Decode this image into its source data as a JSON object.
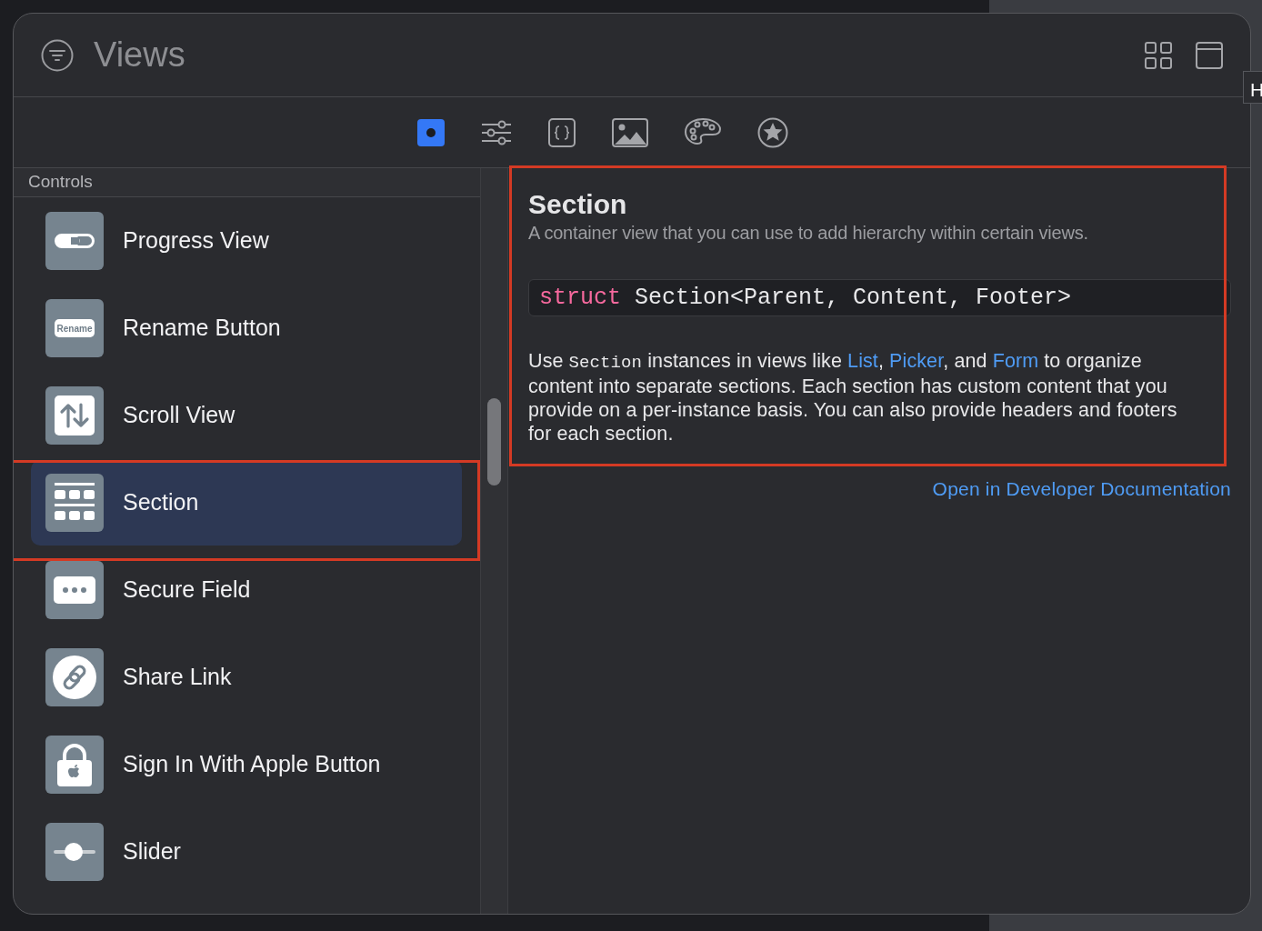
{
  "window": {
    "title": "Views"
  },
  "tooltip": {
    "text": "H"
  },
  "tabs": [
    {
      "kind": "views",
      "selected": true
    },
    {
      "kind": "modifiers",
      "selected": false
    },
    {
      "kind": "snippets",
      "selected": false
    },
    {
      "kind": "media",
      "selected": false
    },
    {
      "kind": "colors",
      "selected": false
    },
    {
      "kind": "symbols",
      "selected": false
    }
  ],
  "sidebar": {
    "group": "Controls",
    "items": [
      {
        "label": "Progress View",
        "kind": "progress",
        "selected": false
      },
      {
        "label": "Rename Button",
        "kind": "rename",
        "icon_text": "Rename",
        "selected": false
      },
      {
        "label": "Scroll View",
        "kind": "scroll",
        "selected": false
      },
      {
        "label": "Section",
        "kind": "section",
        "selected": true
      },
      {
        "label": "Secure Field",
        "kind": "secure",
        "selected": false
      },
      {
        "label": "Share Link",
        "kind": "link",
        "selected": false
      },
      {
        "label": "Sign In With Apple Button",
        "kind": "lock",
        "selected": false
      },
      {
        "label": "Slider",
        "kind": "slider",
        "selected": false
      }
    ]
  },
  "detail": {
    "title": "Section",
    "summary": "A container view that you can use to add hierarchy within certain views.",
    "declaration": {
      "keyword": "struct",
      "rest": "Section<Parent, Content, Footer>"
    },
    "body": [
      {
        "kind": "text",
        "text": "Use "
      },
      {
        "kind": "code",
        "text": "Section"
      },
      {
        "kind": "text",
        "text": " instances in views like "
      },
      {
        "kind": "link",
        "text": "List"
      },
      {
        "kind": "text",
        "text": ", "
      },
      {
        "kind": "link",
        "text": "Picker"
      },
      {
        "kind": "text",
        "text": ", and "
      },
      {
        "kind": "link",
        "text": "Form"
      },
      {
        "kind": "text",
        "text": " to organize content into separate sections. Each section has custom content that you provide on a per-instance basis. You can also provide headers and footers for each section."
      }
    ],
    "doc_link": "Open in Developer Documentation"
  }
}
